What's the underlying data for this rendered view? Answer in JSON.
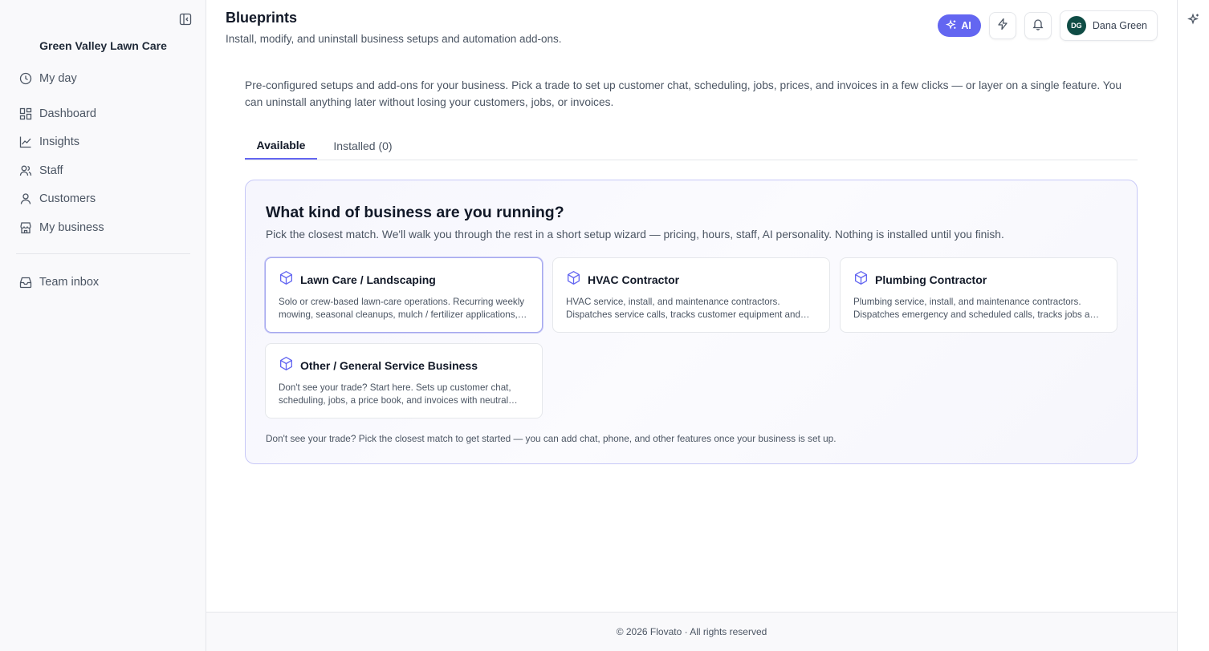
{
  "sidebar": {
    "business_name": "Green Valley Lawn Care",
    "items": [
      {
        "label": "My day",
        "icon": "clock-icon"
      },
      {
        "label": "Dashboard",
        "icon": "dashboard-icon"
      },
      {
        "label": "Insights",
        "icon": "chart-line-icon"
      },
      {
        "label": "Staff",
        "icon": "users-icon"
      },
      {
        "label": "Customers",
        "icon": "user-icon"
      },
      {
        "label": "My business",
        "icon": "store-icon"
      },
      {
        "label": "Team inbox",
        "icon": "inbox-icon"
      }
    ]
  },
  "header": {
    "title": "Blueprints",
    "subtitle": "Install, modify, and uninstall business setups and automation add-ons.",
    "ai_label": "AI",
    "user": {
      "initials": "DG",
      "name": "Dana Green"
    }
  },
  "intro": "Pre-configured setups and add-ons for your business. Pick a trade to set up customer chat, scheduling, jobs, prices, and invoices in a few clicks — or layer on a single feature. You can uninstall anything later without losing your customers, jobs, or invoices.",
  "tabs": [
    {
      "label": "Available",
      "active": true
    },
    {
      "label": "Installed (0)",
      "active": false
    }
  ],
  "panel": {
    "title": "What kind of business are you running?",
    "subtitle": "Pick the closest match. We'll walk you through the rest in a short setup wizard — pricing, hours, staff, AI personality. Nothing is installed until you finish.",
    "cards": [
      {
        "title": "Lawn Care / Landscaping",
        "desc": "Solo or crew-based lawn-care operations. Recurring weekly mowing, seasonal cleanups, mulch / fertilizer applications, and more.",
        "selected": true
      },
      {
        "title": "HVAC Contractor",
        "desc": "HVAC service, install, and maintenance contractors. Dispatches service calls, tracks customer equipment and maintenance plans.",
        "selected": false
      },
      {
        "title": "Plumbing Contractor",
        "desc": "Plumbing service, install, and maintenance contractors. Dispatches emergency and scheduled calls, tracks jobs and estimates.",
        "selected": false
      },
      {
        "title": "Other / General Service Business",
        "desc": "Don't see your trade? Start here. Sets up customer chat, scheduling, jobs, a price book, and invoices with neutral defaults.",
        "selected": false
      }
    ],
    "footnote": "Don't see your trade? Pick the closest match to get started — you can add chat, phone, and other features once your business is set up."
  },
  "footer": "© 2026 Flovato · All rights reserved",
  "colors": {
    "accent": "#6366f1",
    "avatar_bg": "#0f4c45",
    "panel_border": "#c7c8f7"
  }
}
